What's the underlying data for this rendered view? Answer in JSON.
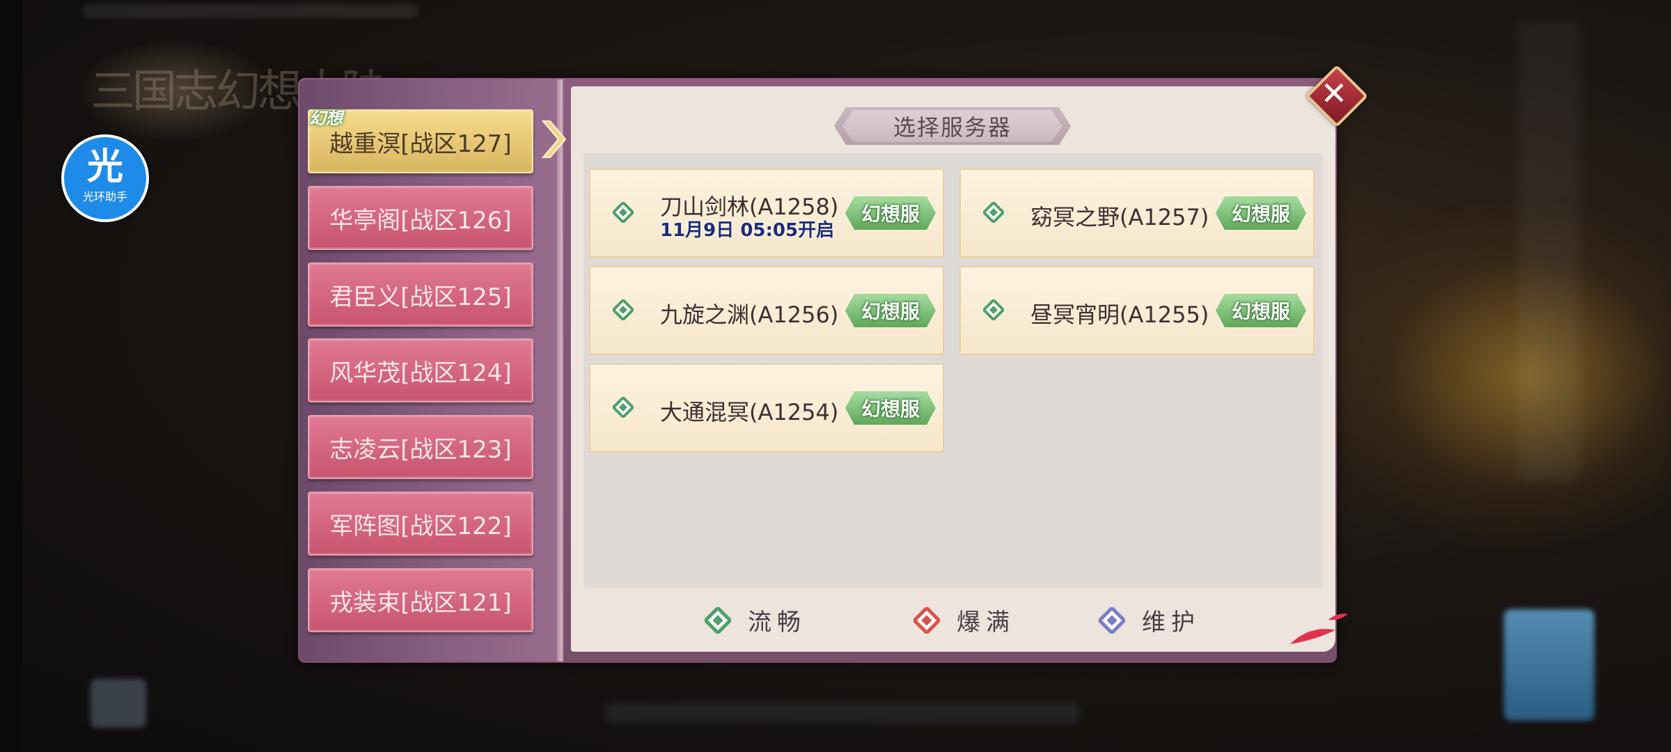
{
  "app": {
    "watermark_title": "三国志幻想大陆",
    "helper": {
      "glyph": "光",
      "label": "光环助手"
    }
  },
  "dialog": {
    "title": "选择服务器",
    "close_label": "✕",
    "active_zone_tag": "幻想"
  },
  "zones": [
    {
      "label": "越重溟[战区127]",
      "active": true
    },
    {
      "label": "华亭阁[战区126]",
      "active": false
    },
    {
      "label": "君臣义[战区125]",
      "active": false
    },
    {
      "label": "风华茂[战区124]",
      "active": false
    },
    {
      "label": "志凌云[战区123]",
      "active": false
    },
    {
      "label": "军阵图[战区122]",
      "active": false
    },
    {
      "label": "戎装束[战区121]",
      "active": false
    }
  ],
  "servers": [
    {
      "name": "刀山剑林(A1258)",
      "badge": "幻想服",
      "open_time": "11月9日 05:05开启",
      "status": "smooth"
    },
    {
      "name": "窈冥之野(A1257)",
      "badge": "幻想服",
      "status": "smooth"
    },
    {
      "name": "九旋之渊(A1256)",
      "badge": "幻想服",
      "status": "smooth"
    },
    {
      "name": "昼冥宵明(A1255)",
      "badge": "幻想服",
      "status": "smooth"
    },
    {
      "name": "大通混冥(A1254)",
      "badge": "幻想服",
      "status": "smooth"
    }
  ],
  "legend": [
    {
      "label": "流畅",
      "color": "#4fa06a"
    },
    {
      "label": "爆满",
      "color": "#d9534a"
    },
    {
      "label": "维护",
      "color": "#7a7fc4"
    }
  ],
  "colors": {
    "status_smooth": "#4fa06a",
    "status_full": "#d9534a",
    "status_maintenance": "#7a7fc4",
    "active_tab": "#e9c875",
    "inactive_tab": "#d4647f",
    "badge_green": "#6bb567"
  }
}
